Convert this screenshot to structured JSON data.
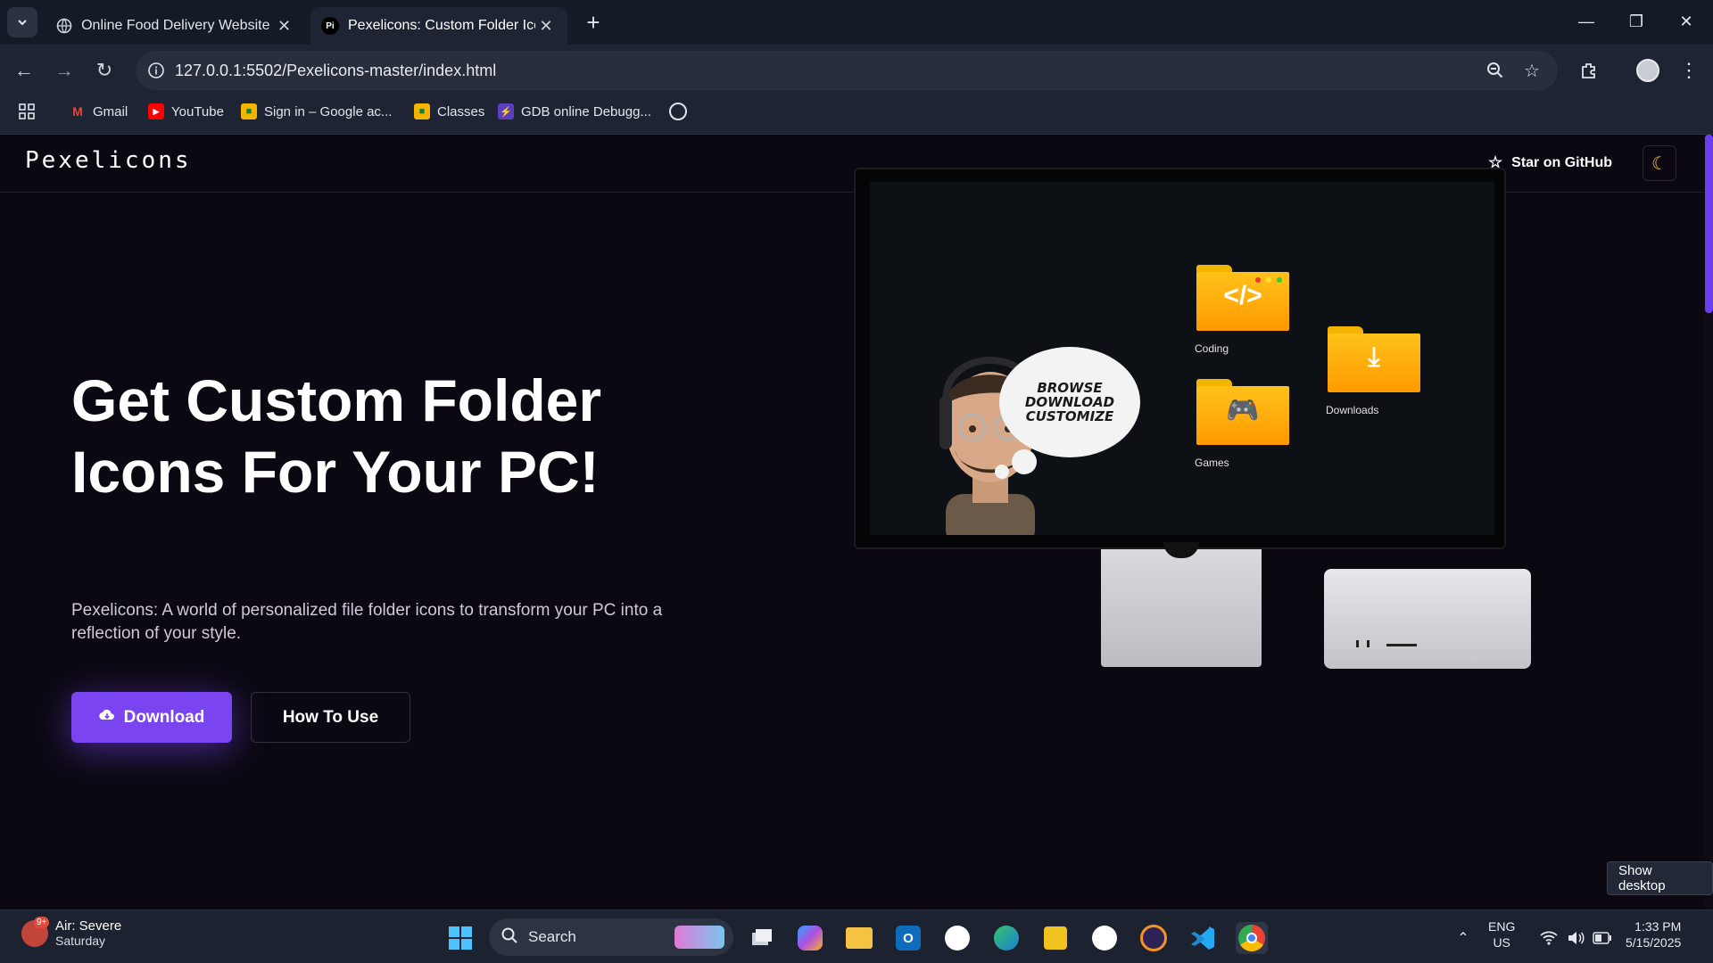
{
  "browser": {
    "tabs": [
      {
        "title": "Online Food Delivery Website",
        "active": false
      },
      {
        "title": "Pexelicons: Custom Folder Icons",
        "active": true
      }
    ],
    "url": "127.0.0.1:5502/Pexelicons-master/index.html",
    "bookmarks": [
      "Gmail",
      "YouTube",
      "Sign in – Google ac...",
      "Classes",
      "GDB online Debugg..."
    ]
  },
  "site": {
    "logo": "Pexelicons",
    "star_label": "Star on GitHub",
    "headline": "Get Custom Folder Icons For Your PC!",
    "description": "Pexelicons: A world of personalized file folder icons to transform your PC into a reflection of your style.",
    "download_label": "Download",
    "howto_label": "How To Use",
    "illustration": {
      "bubble_lines": [
        "BROWSE",
        "DOWNLOAD",
        "CUSTOMIZE"
      ],
      "folders": [
        "Coding",
        "Games",
        "Downloads"
      ]
    }
  },
  "taskbar": {
    "weather_title": "Air: Severe",
    "weather_day": "Saturday",
    "weather_badge": "9+",
    "search_placeholder": "Search",
    "lang_top": "ENG",
    "lang_bottom": "US",
    "time": "1:33 PM",
    "date": "5/15/2025",
    "show_desktop": "Show desktop"
  },
  "colors": {
    "accent": "#7a45f0",
    "page_bg": "#0b0812",
    "folder": "#ffb000"
  }
}
